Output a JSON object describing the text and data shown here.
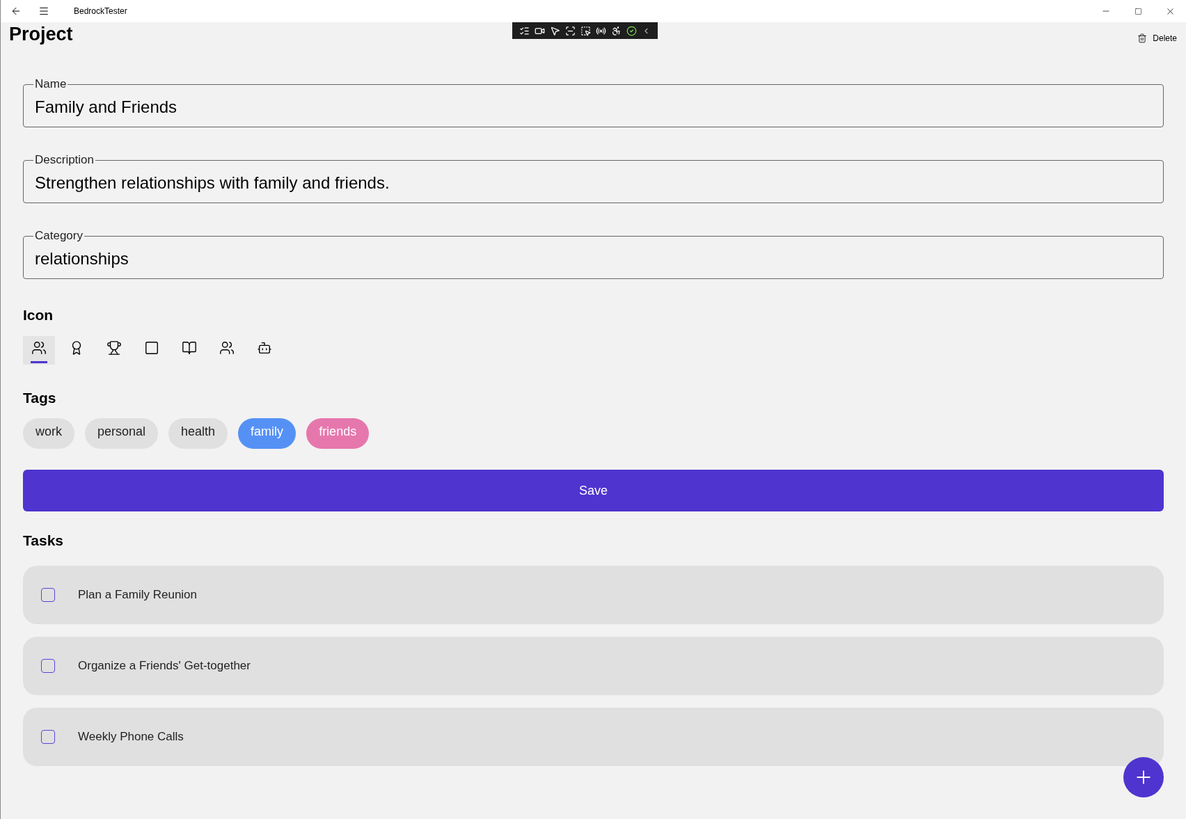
{
  "window": {
    "title": "BedrockTester"
  },
  "page": {
    "title": "Project",
    "delete_label": "Delete"
  },
  "fields": [
    {
      "label": "Name",
      "value": "Family and Friends"
    },
    {
      "label": "Description",
      "value": "Strengthen relationships with family and friends."
    },
    {
      "label": "Category",
      "value": "relationships"
    }
  ],
  "icon_section": {
    "heading": "Icon",
    "icons": [
      {
        "kind": "people",
        "selected": true
      },
      {
        "kind": "ribbon",
        "selected": false
      },
      {
        "kind": "trophy",
        "selected": false
      },
      {
        "kind": "square",
        "selected": false
      },
      {
        "kind": "book",
        "selected": false
      },
      {
        "kind": "people",
        "selected": false
      },
      {
        "kind": "bot",
        "selected": false
      }
    ]
  },
  "tags_section": {
    "heading": "Tags",
    "tags": [
      {
        "label": "work",
        "selected": false
      },
      {
        "label": "personal",
        "selected": false
      },
      {
        "label": "health",
        "selected": false
      },
      {
        "label": "family",
        "selected": true,
        "color": "#5591f5"
      },
      {
        "label": "friends",
        "selected": true,
        "color": "#e677ad"
      }
    ]
  },
  "save_button": "Save",
  "tasks_section": {
    "heading": "Tasks",
    "tasks": [
      {
        "title": "Plan a Family Reunion",
        "checked": false
      },
      {
        "title": "Organize a Friends' Get-together",
        "checked": false
      },
      {
        "title": "Weekly Phone Calls",
        "checked": false
      }
    ]
  }
}
